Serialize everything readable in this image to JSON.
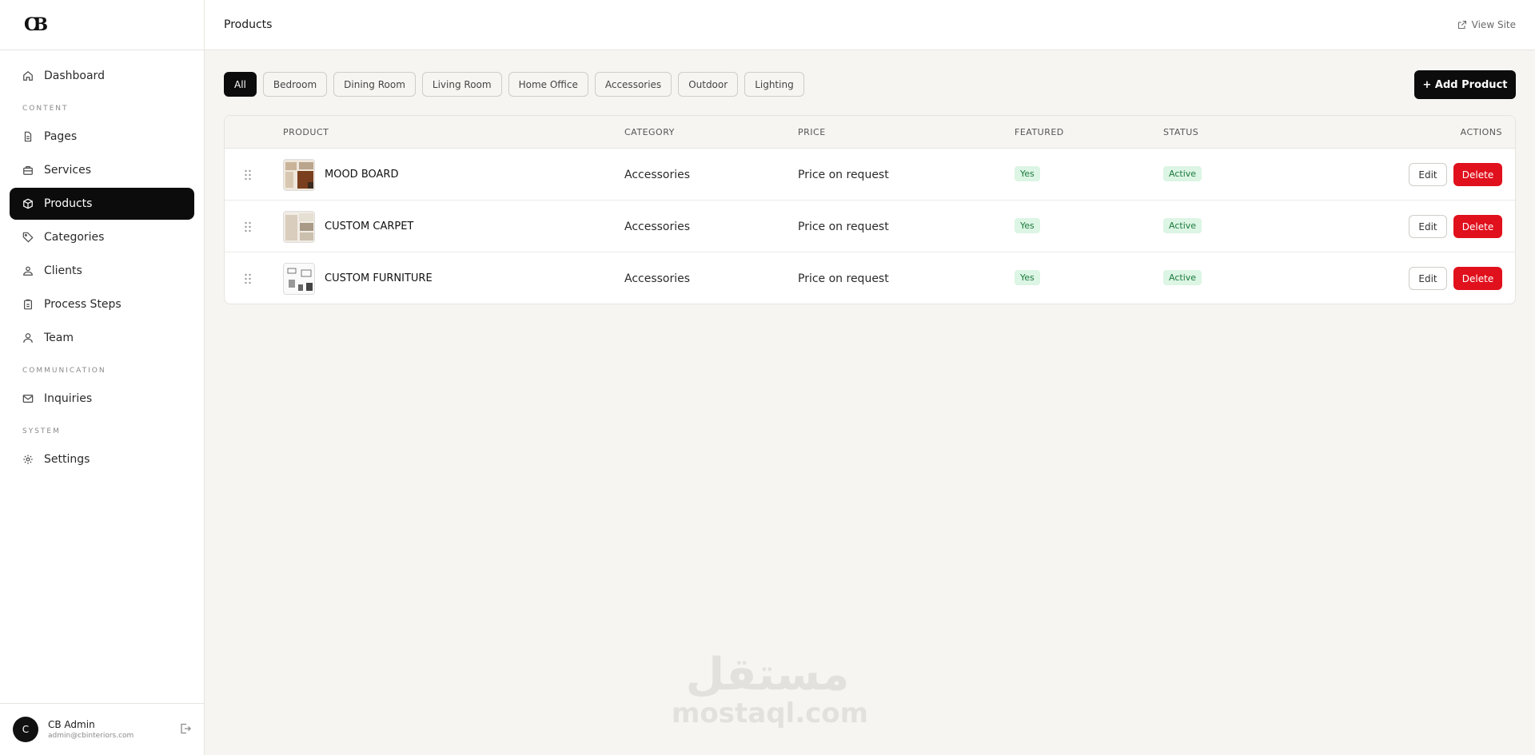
{
  "logo": "CB",
  "sidebar": {
    "items": [
      {
        "label": "Dashboard",
        "icon": "home-icon"
      },
      {
        "label": "Pages",
        "icon": "file-icon"
      },
      {
        "label": "Services",
        "icon": "briefcase-icon"
      },
      {
        "label": "Products",
        "icon": "box-icon"
      },
      {
        "label": "Categories",
        "icon": "tag-icon"
      },
      {
        "label": "Clients",
        "icon": "users-icon"
      },
      {
        "label": "Process Steps",
        "icon": "clipboard-icon"
      },
      {
        "label": "Team",
        "icon": "team-icon"
      },
      {
        "label": "Inquiries",
        "icon": "mail-icon"
      },
      {
        "label": "Settings",
        "icon": "gear-icon"
      }
    ],
    "sections": {
      "content": "CONTENT",
      "communication": "COMMUNICATION",
      "system": "SYSTEM"
    },
    "active": "Products"
  },
  "user": {
    "initial": "C",
    "name": "CB Admin",
    "email": "admin@cbinteriors.com"
  },
  "header": {
    "title": "Products",
    "view_site": "View Site"
  },
  "filters": [
    "All",
    "Bedroom",
    "Dining Room",
    "Living Room",
    "Home Office",
    "Accessories",
    "Outdoor",
    "Lighting"
  ],
  "active_filter": "All",
  "add_button": "+ Add Product",
  "table": {
    "headers": {
      "product": "PRODUCT",
      "category": "CATEGORY",
      "price": "PRICE",
      "featured": "FEATURED",
      "status": "STATUS",
      "actions": "ACTIONS"
    },
    "rows": [
      {
        "name": "MOOD BOARD",
        "category": "Accessories",
        "price": "Price on request",
        "featured": "Yes",
        "status": "Active",
        "edit": "Edit",
        "delete": "Delete"
      },
      {
        "name": "CUSTOM CARPET",
        "category": "Accessories",
        "price": "Price on request",
        "featured": "Yes",
        "status": "Active",
        "edit": "Edit",
        "delete": "Delete"
      },
      {
        "name": "CUSTOM FURNITURE",
        "category": "Accessories",
        "price": "Price on request",
        "featured": "Yes",
        "status": "Active",
        "edit": "Edit",
        "delete": "Delete"
      }
    ]
  },
  "watermark": {
    "arabic": "مستقل",
    "latin": "mostaql.com"
  },
  "colors": {
    "primary": "#0c0c0c",
    "danger": "#e0101c",
    "badge_bg": "#dcf5e4",
    "badge_text": "#1d7a3e",
    "page_bg": "#f6f5f2"
  }
}
